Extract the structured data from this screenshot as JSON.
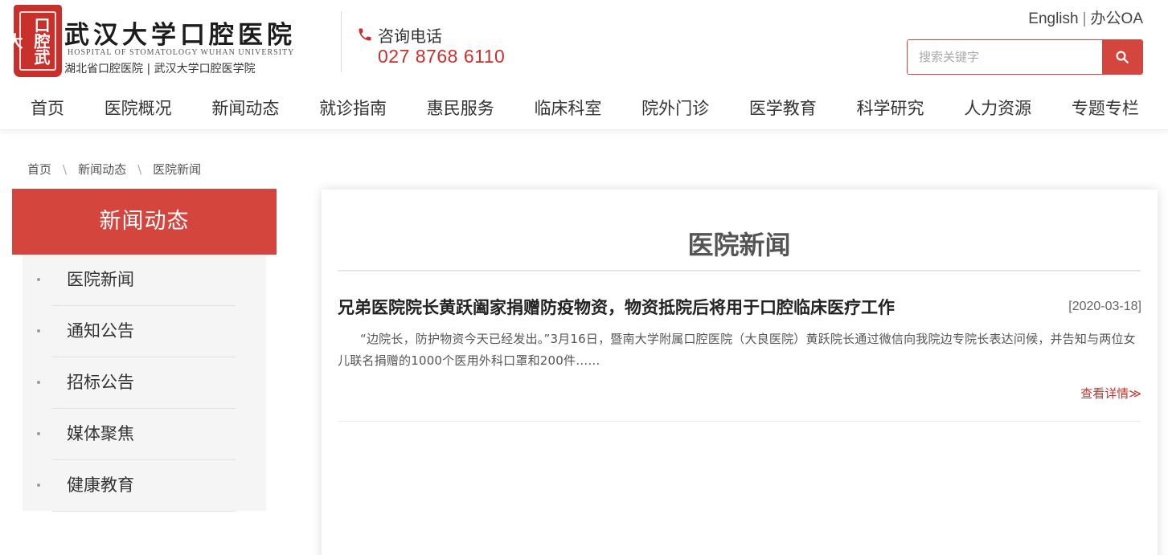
{
  "header": {
    "logo_seal_text": "口腔武大",
    "title": "武汉大学口腔医院",
    "subtitle_en": "HOSPITAL OF STOMATOLOGY WUHAN UNIVERSITY",
    "subtitle_cn": "湖北省口腔医院 | 武汉大学口腔医学院",
    "hotline_label": "咨询电话",
    "hotline_number": "027 8768 6110",
    "phone_icon": "phone-icon",
    "top_links": {
      "english": "English",
      "separator": "|",
      "oa": "办公OA"
    },
    "search": {
      "placeholder": "搜索关键字",
      "value": "",
      "icon": "search-icon"
    }
  },
  "nav": {
    "items": [
      "首页",
      "医院概况",
      "新闻动态",
      "就诊指南",
      "惠民服务",
      "临床科室",
      "院外门诊",
      "医学教育",
      "科学研究",
      "人力资源",
      "专题专栏"
    ]
  },
  "breadcrumb": {
    "items": [
      "首页",
      "新闻动态",
      "医院新闻"
    ],
    "separator": "\\"
  },
  "sidebar": {
    "title": "新闻动态",
    "items": [
      "医院新闻",
      "通知公告",
      "招标公告",
      "媒体聚焦",
      "健康教育"
    ]
  },
  "main": {
    "title": "医院新闻",
    "news": [
      {
        "title": "兄弟医院院长黄跃阖家捐赠防疫物资，物资抵院后将用于口腔临床医疗工作",
        "date": "[2020-03-18]",
        "summary": "“边院长，防护物资今天已经发出。”3月16日，暨南大学附属口腔医院（大良医院）黄跃院长通过微信向我院边专院长表达问候，并告知与两位女儿联名捐赠的1000个医用外科口罩和200件……",
        "more": "查看详情≫"
      }
    ]
  },
  "colors": {
    "brand_red": "#d4453e",
    "text_dark": "#333333",
    "sidebar_bg": "#f5f5f5"
  }
}
